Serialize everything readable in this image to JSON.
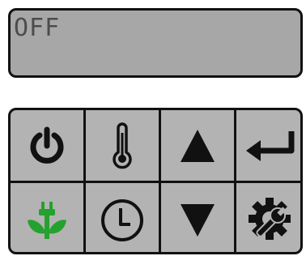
{
  "display": {
    "text": "OFF"
  },
  "keypad": {
    "keys": [
      {
        "name": "power",
        "icon": "power-icon"
      },
      {
        "name": "temperature",
        "icon": "thermometer-icon"
      },
      {
        "name": "up",
        "icon": "triangle-up-icon"
      },
      {
        "name": "enter",
        "icon": "enter-arrow-icon"
      },
      {
        "name": "eco",
        "icon": "plant-plug-icon"
      },
      {
        "name": "timer",
        "icon": "clock-icon"
      },
      {
        "name": "down",
        "icon": "triangle-down-icon"
      },
      {
        "name": "settings",
        "icon": "gear-wrench-icon"
      }
    ],
    "colors": {
      "background": "#b3b3b3",
      "icon": "#111111",
      "eco_icon": "#24a12e",
      "display_background": "#a7a7a7",
      "display_text": "#4c4c4c"
    }
  }
}
